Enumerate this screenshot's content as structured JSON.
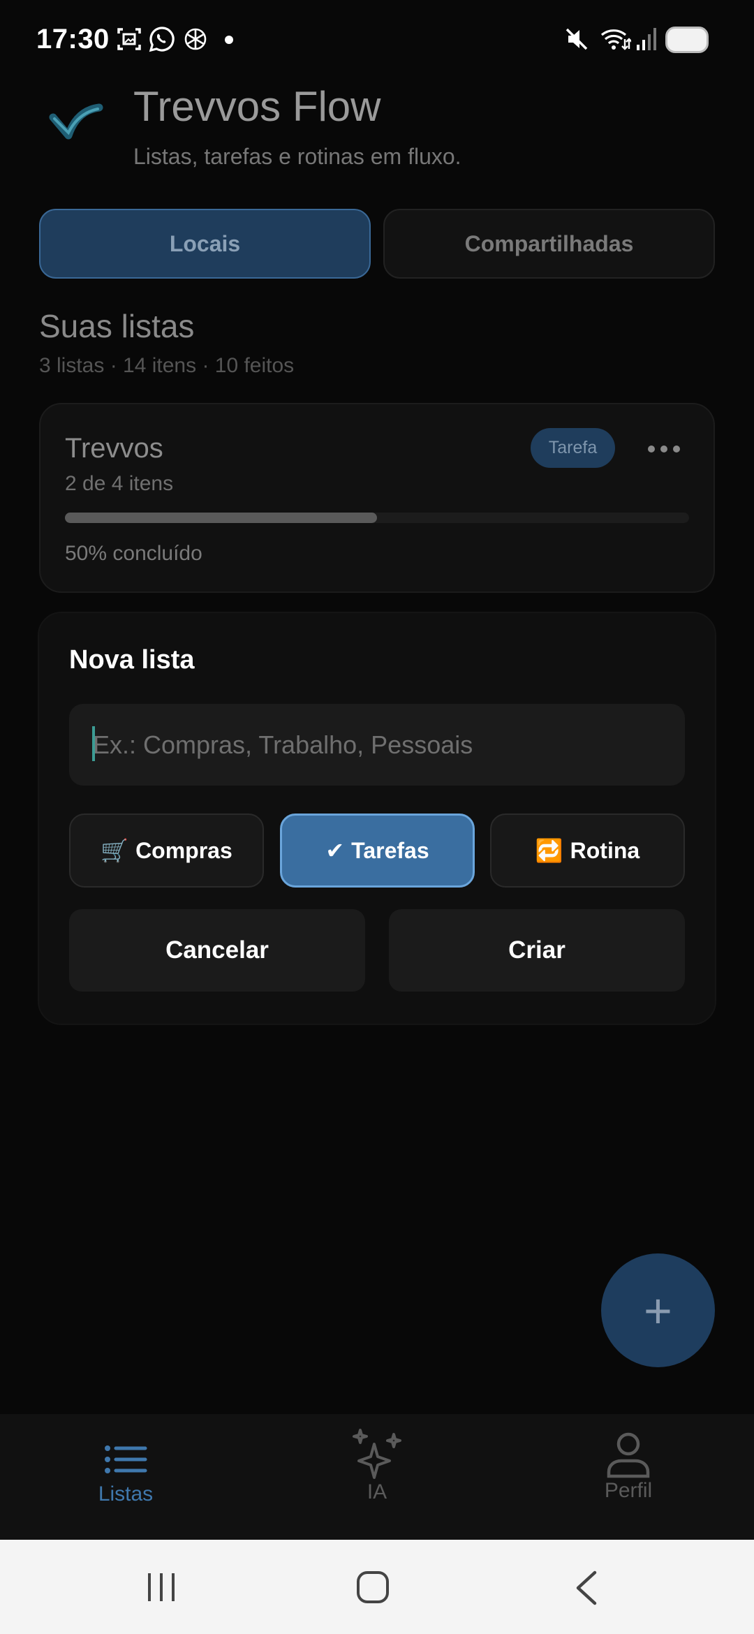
{
  "status_bar": {
    "time": "17:30"
  },
  "header": {
    "title": "Trevvos Flow",
    "subtitle": "Listas, tarefas e rotinas em fluxo."
  },
  "tabs": [
    {
      "label": "Locais",
      "active": true
    },
    {
      "label": "Compartilhadas",
      "active": false
    }
  ],
  "section": {
    "title": "Suas listas",
    "summary": "3 listas · 14 itens · 10 feitos"
  },
  "lists": [
    {
      "name": "Trevvos",
      "count_text": "2 de 4 itens",
      "badge": "Tarefa",
      "progress_percent": 50,
      "progress_text": "50% concluído"
    }
  ],
  "new_list": {
    "title": "Nova lista",
    "input_placeholder": "Ex.: Compras, Trabalho, Pessoais",
    "input_value": "",
    "types": [
      {
        "emoji": "🛒",
        "label": "Compras",
        "selected": false
      },
      {
        "emoji": "✔",
        "label": "Tarefas",
        "selected": true
      },
      {
        "emoji": "🔁",
        "label": "Rotina",
        "selected": false
      }
    ],
    "cancel_label": "Cancelar",
    "create_label": "Criar"
  },
  "fab": {
    "icon": "plus-icon",
    "label": "+"
  },
  "bottom_nav": [
    {
      "label": "Listas",
      "icon": "list-icon",
      "active": true
    },
    {
      "label": "IA",
      "icon": "sparkles-icon",
      "active": false
    },
    {
      "label": "Perfil",
      "icon": "user-icon",
      "active": false
    }
  ],
  "colors": {
    "accent": "#3a6ea0",
    "accent_dark": "#1f3d5c",
    "background": "#080808",
    "nav_active": "#3f78ad"
  }
}
